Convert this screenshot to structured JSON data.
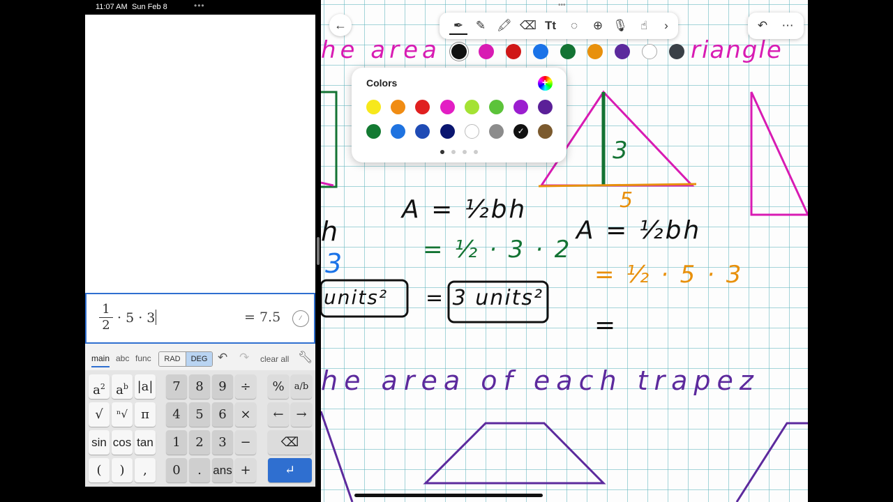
{
  "status_bar": {
    "time": "11:07 AM",
    "date": "Sun Feb 8",
    "multitask": "•••"
  },
  "calculator": {
    "expression": {
      "fraction_num": "1",
      "fraction_den": "2",
      "rest": "· 5 · 3"
    },
    "result": "= 7.5",
    "format_button_icon": "fraction-toggle-icon",
    "tabs": [
      "main",
      "abc",
      "func"
    ],
    "active_tab": "main",
    "angle_modes": [
      "RAD",
      "DEG"
    ],
    "selected_angle_mode": "DEG",
    "undo_icon": "undo-icon",
    "redo_icon": "redo-icon",
    "clear_all": "clear all",
    "settings_icon": "wrench-icon",
    "keys": {
      "square": "a",
      "power": "a",
      "abs": "|a|",
      "sqrt": "√",
      "nthroot": "ⁿ√",
      "pi": "π",
      "sin": "sin",
      "cos": "cos",
      "tan": "tan",
      "lparen": "(",
      "rparen": ")",
      "comma": ",",
      "seven": "7",
      "eight": "8",
      "nine": "9",
      "divide": "÷",
      "four": "4",
      "five": "5",
      "six": "6",
      "times": "×",
      "one": "1",
      "two": "2",
      "three": "3",
      "minus": "−",
      "zero": "0",
      "dot": ".",
      "ans": "ans",
      "plus": "+",
      "percent": "%",
      "frac": "a/b",
      "left_arrow": "←",
      "right_arrow": "→",
      "backspace": "⌫",
      "enter": "↵"
    }
  },
  "notes": {
    "toolbar_icons": [
      "pen-icon",
      "pencil-icon",
      "highlighter-icon",
      "eraser-icon",
      "text-icon",
      "lasso-icon",
      "add-icon",
      "microphone-icon",
      "finger-draw-icon",
      "chevron-right-icon"
    ],
    "back_icon": "back-arrow-icon",
    "undo_icon": "undo-icon",
    "more_icon": "more-icon",
    "quick_colors": [
      "#111111",
      "#d81bb3",
      "#d01818",
      "#1a73e8",
      "#137333",
      "#e8900c",
      "#5c2a9d",
      "#ffffff",
      "#3a3f46"
    ],
    "selected_quick_color": "#111111",
    "colors_panel": {
      "title": "Colors",
      "wheel_icon": "color-wheel-icon",
      "row1": [
        "#f7e81b",
        "#f08c13",
        "#e02020",
        "#e31ec4",
        "#a4e234",
        "#5cc33a",
        "#9b1ecf",
        "#5b2098"
      ],
      "row2": [
        "#137a32",
        "#1f73e0",
        "#1f4bb5",
        "#0a1670",
        "#ffffff",
        "#8c8c8c",
        "#111111",
        "#7b5a2e"
      ],
      "selected": "#111111",
      "pages": 4,
      "current_page": 1
    },
    "handwriting": {
      "heading_top_left": "he area",
      "heading_top_right": "riangle",
      "heading_mid": "he area of each trapez",
      "left_h": "h",
      "left_3": "3",
      "left_units": "units²",
      "mid_formula": "A = ½bh",
      "mid_step": "= ½ · 3 · 2",
      "mid_answer": "= 3 units²",
      "right_formula": "A = ½bh",
      "right_step": "= ½ · 5 · 3",
      "right_eq": "=",
      "tri_height": "3",
      "tri_base": "5"
    }
  }
}
